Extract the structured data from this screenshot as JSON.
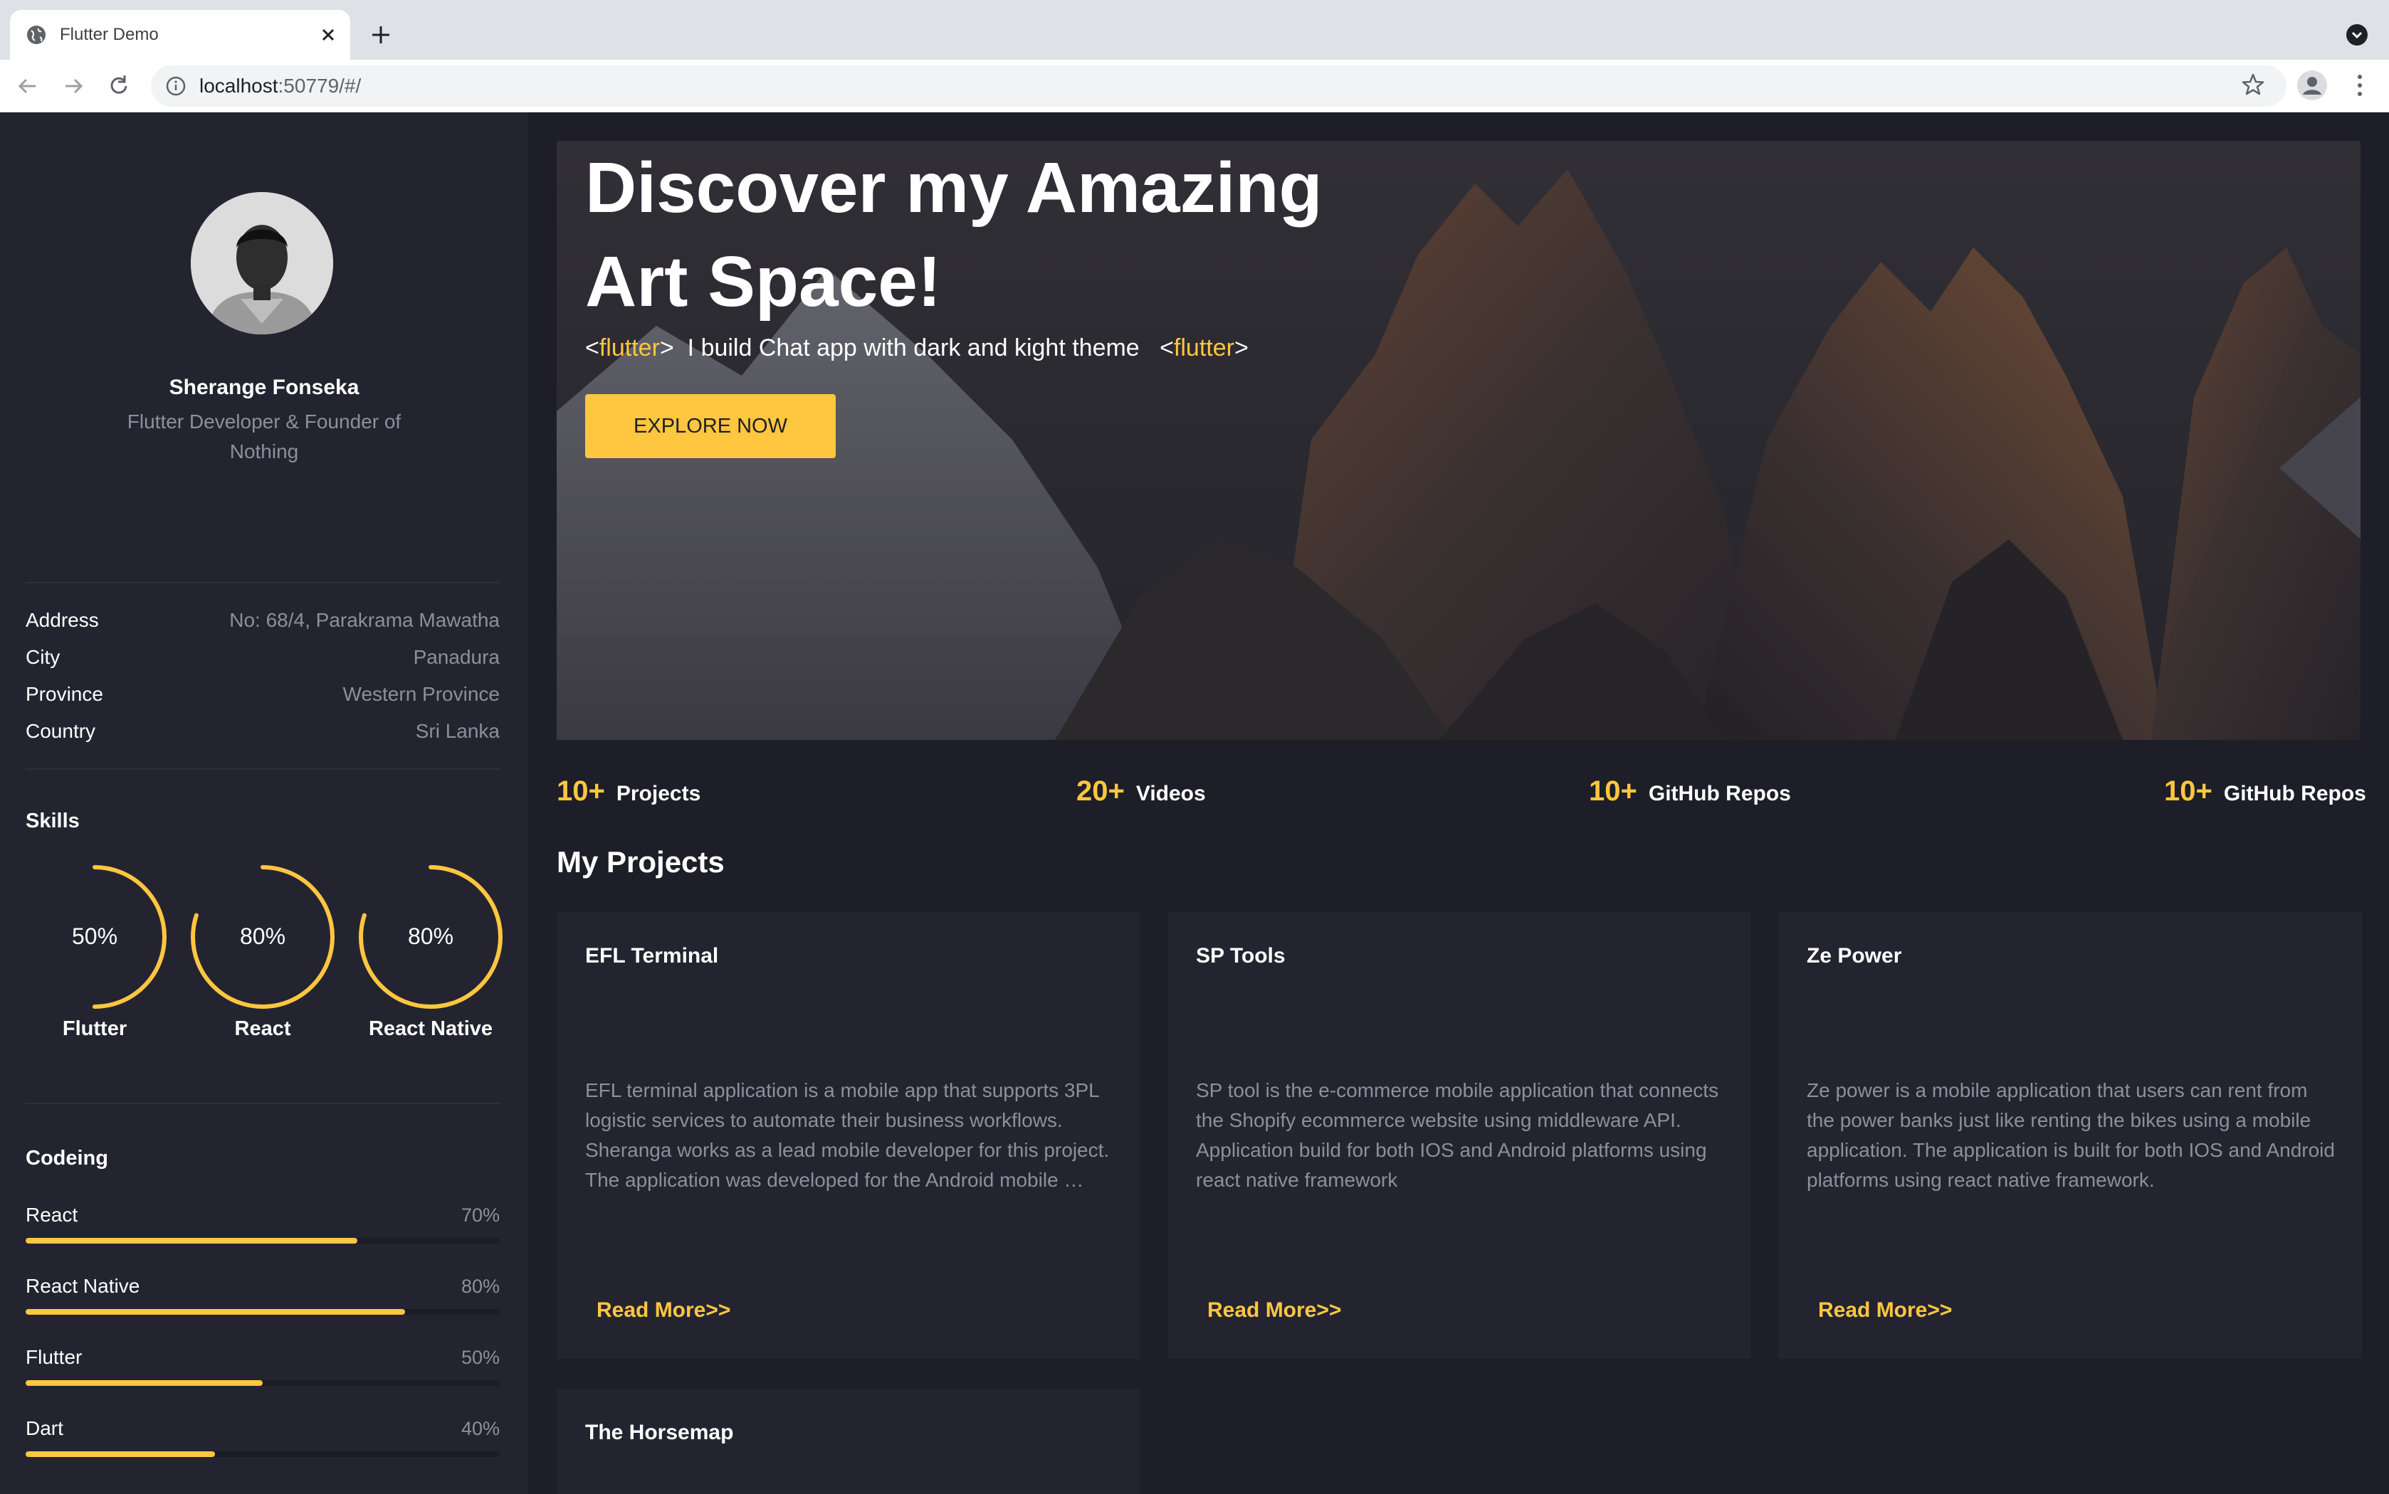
{
  "browser": {
    "tab_title": "Flutter Demo",
    "url_host": "localhost",
    "url_rest": ":50779/#/"
  },
  "profile": {
    "name": "Sherange Fonseka",
    "role": "Flutter Developer & Founder of Nothing"
  },
  "info": [
    {
      "label": "Address",
      "value": "No: 68/4, Parakrama Mawatha"
    },
    {
      "label": "City",
      "value": "Panadura"
    },
    {
      "label": "Province",
      "value": "Western Province"
    },
    {
      "label": "Country",
      "value": "Sri Lanka"
    }
  ],
  "skills": {
    "title": "Skills",
    "items": [
      {
        "name": "Flutter",
        "label": "50%",
        "value": 0.5
      },
      {
        "name": "React",
        "label": "80%",
        "value": 0.8
      },
      {
        "name": "React Native",
        "label": "80%",
        "value": 0.8
      }
    ]
  },
  "coding": {
    "title": "Codeing",
    "items": [
      {
        "name": "React",
        "label": "70%",
        "value": 0.7
      },
      {
        "name": "React Native",
        "label": "80%",
        "value": 0.8
      },
      {
        "name": "Flutter",
        "label": "50%",
        "value": 0.5
      },
      {
        "name": "Dart",
        "label": "40%",
        "value": 0.4
      }
    ]
  },
  "hero": {
    "title_line1": "Discover my Amazing",
    "title_line2": "Art Space!",
    "tag_open": "<",
    "tag_word": "flutter",
    "tag_close": ">",
    "subtitle": "I build Chat app with dark and kight theme",
    "button": "EXPLORE NOW"
  },
  "stats": [
    {
      "num": "10+",
      "label": "Projects"
    },
    {
      "num": "20+",
      "label": "Videos"
    },
    {
      "num": "10+",
      "label": "GitHub Repos"
    },
    {
      "num": "10+",
      "label": "GitHub Repos"
    }
  ],
  "projects": {
    "title": "My Projects",
    "items": [
      {
        "title": "EFL Terminal",
        "desc": "EFL terminal application is a mobile app that supports 3PL logistic services to automate their business workflows. Sheranga works as a lead mobile developer for this project. The application was developed for the Android mobile …",
        "link": "Read More>>"
      },
      {
        "title": "SP Tools",
        "desc": "SP tool is the e-commerce mobile application that connects the Shopify ecommerce website using middleware API. Application build for both IOS and Android platforms using react native framework",
        "link": "Read More>>"
      },
      {
        "title": "Ze Power",
        "desc": "Ze power is a mobile application that users can rent from the power banks just like renting the bikes using a mobile application. The application is built for both IOS and Android platforms using react native framework.",
        "link": "Read More>>"
      },
      {
        "title": "The Horsemap"
      }
    ]
  },
  "colors": {
    "accent": "#ffc640",
    "sidebar": "#242431",
    "background": "#1e1e28",
    "card": "#242431"
  }
}
